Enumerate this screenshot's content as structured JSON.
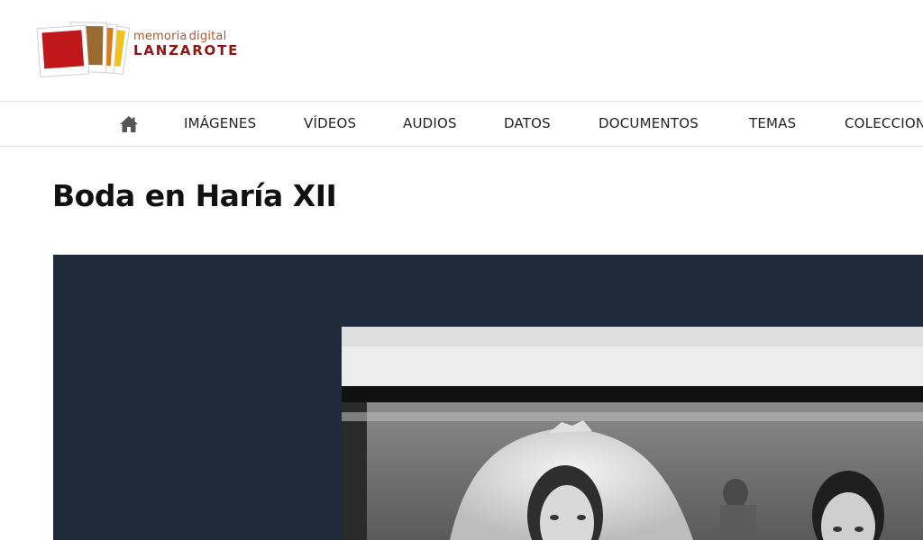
{
  "brand": {
    "line1_a": "memoria",
    "line1_b": "digital",
    "line2": "LANZAROTE",
    "colors": {
      "red": "#c0171b",
      "orange": "#d97b1c",
      "yellow": "#f0c21a",
      "brown": "#8c1515"
    }
  },
  "nav": {
    "home_icon": "home-icon",
    "items": [
      {
        "label": "IMÁGENES"
      },
      {
        "label": "VÍDEOS"
      },
      {
        "label": "AUDIOS"
      },
      {
        "label": "DATOS"
      },
      {
        "label": "DOCUMENTOS"
      },
      {
        "label": "TEMAS"
      },
      {
        "label": "COLECCIONES"
      }
    ]
  },
  "page": {
    "title": "Boda en Haría XII"
  },
  "viewer": {
    "background": "#1f2a3a"
  }
}
